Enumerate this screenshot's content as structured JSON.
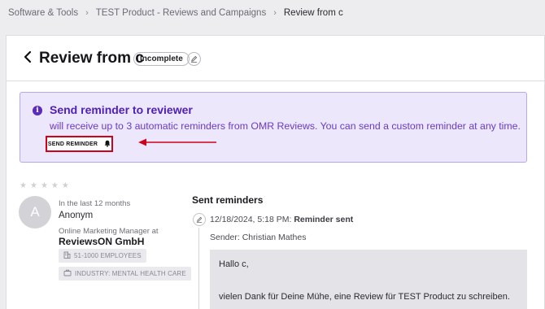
{
  "breadcrumb": {
    "items": [
      "Software & Tools",
      "TEST Product - Reviews and Campaigns",
      "Review from c"
    ],
    "separator": "›"
  },
  "header": {
    "title": "Review from c",
    "status_badge": "Incomplete"
  },
  "alert": {
    "title": "Send reminder to reviewer",
    "text": "will receive up to 3 automatic reminders from OMR Reviews. You can send a custom reminder at any time.",
    "button_label": "SEND REMINDER",
    "accent_color": "#5020b5",
    "highlight_color": "#d0021b"
  },
  "reviewer": {
    "rating": 0,
    "avatar_letter": "A",
    "period": "In the last 12 months",
    "name": "Anonym",
    "role": "Online Marketing Manager at",
    "company": "ReviewsON GmbH",
    "employees_tag": "51-1000 EMPLOYEES",
    "industry_tag": "INDUSTRY: MENTAL HEALTH CARE"
  },
  "reminders": {
    "title": "Sent reminders",
    "event_time": "12/18/2024, 5:18 PM:",
    "event_label": "Reminder sent",
    "sender": "Sender: Christian Mathes",
    "message_greeting": "Hallo c,",
    "message_body": "vielen Dank für Deine Mühe, eine Review für TEST Product zu schreiben."
  }
}
